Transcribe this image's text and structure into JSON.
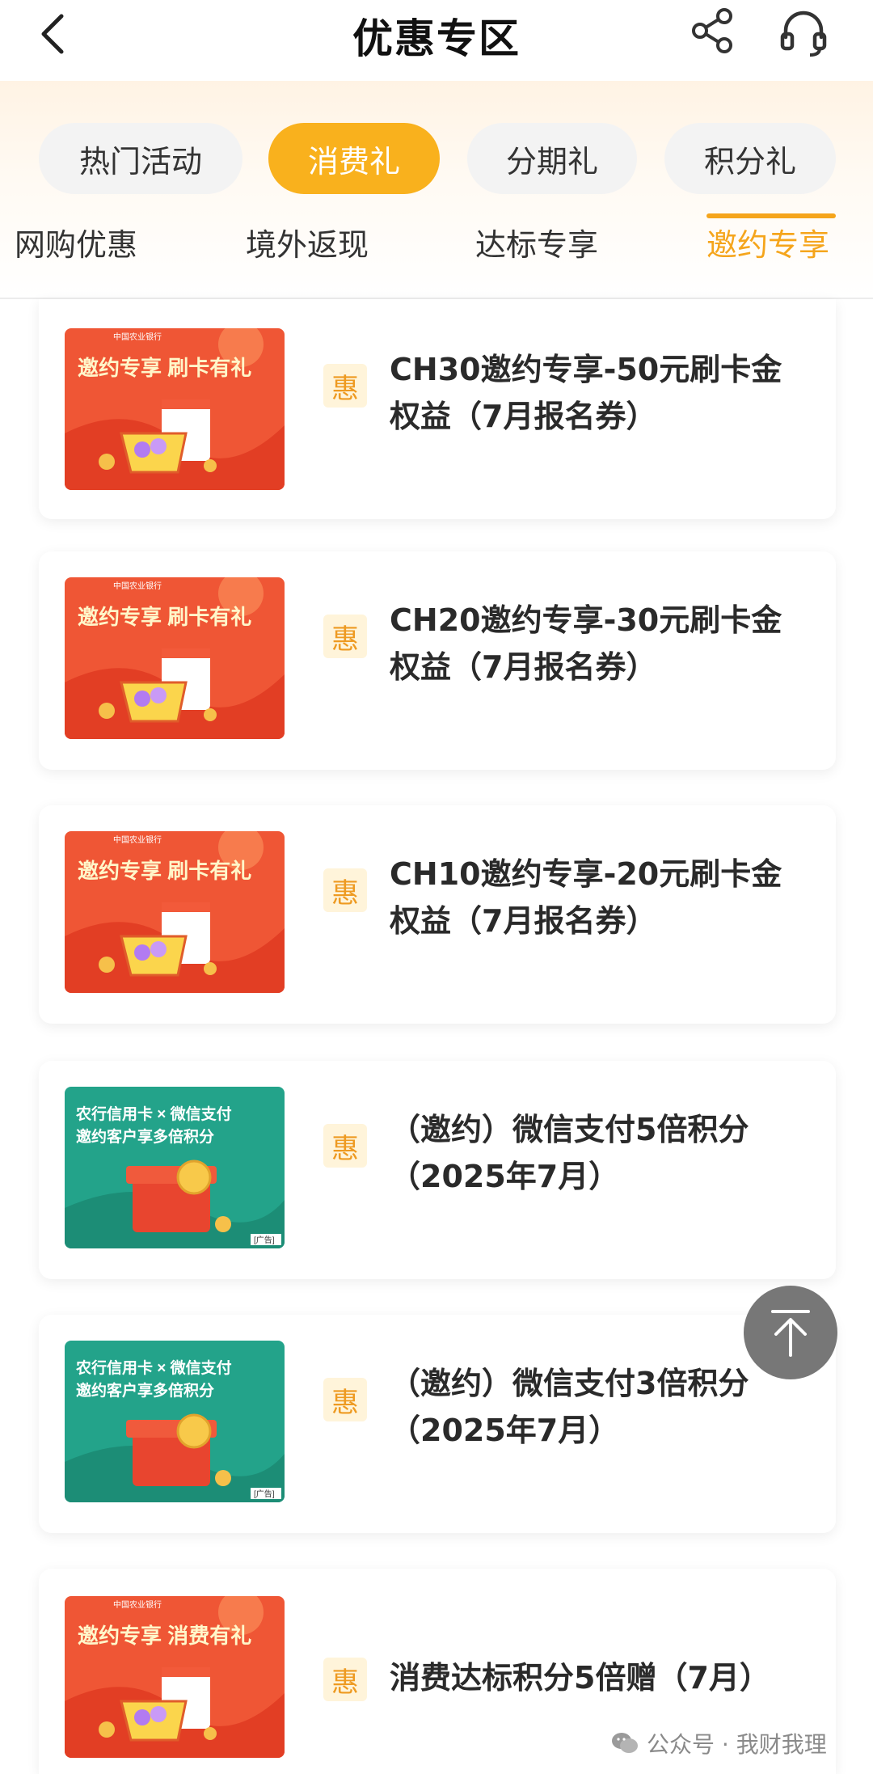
{
  "header": {
    "title": "优惠专区",
    "back_icon": "chevron-left-icon",
    "share_icon": "share-icon",
    "support_icon": "headset-icon"
  },
  "category_tabs": [
    {
      "label": "热门活动",
      "active": false
    },
    {
      "label": "消费礼",
      "active": true
    },
    {
      "label": "分期礼",
      "active": false
    },
    {
      "label": "积分礼",
      "active": false
    }
  ],
  "sub_tabs": [
    {
      "label": "网购优惠",
      "active": false
    },
    {
      "label": "境外返现",
      "active": false
    },
    {
      "label": "达标专享",
      "active": false
    },
    {
      "label": "邀约专享",
      "active": true
    }
  ],
  "banners": {
    "bank_name": "中国农业银行",
    "red_banner_text": "邀约专享 刷卡有礼",
    "red_banner_text_alt": "邀约专享 消费有礼",
    "green_banner_line1": "农行信用卡 × 微信支付",
    "green_banner_line2": "邀约客户享多倍积分",
    "ad_tag": "[广告]"
  },
  "offers": [
    {
      "badge": "惠",
      "title_line1": "CH30邀约专享-50元刷卡金",
      "title_line2": "权益（7月报名券）",
      "banner": "red-card"
    },
    {
      "badge": "惠",
      "title_line1": "CH20邀约专享-30元刷卡金",
      "title_line2": "权益（7月报名券）",
      "banner": "red-card"
    },
    {
      "badge": "惠",
      "title_line1": "CH10邀约专享-20元刷卡金",
      "title_line2": "权益（7月报名券）",
      "banner": "red-card"
    },
    {
      "badge": "惠",
      "title_line1": "（邀约）微信支付5倍积分",
      "title_line2": "（2025年7月）",
      "banner": "green-wechat"
    },
    {
      "badge": "惠",
      "title_line1": "（邀约）微信支付3倍积分",
      "title_line2": "（2025年7月）",
      "banner": "green-wechat"
    },
    {
      "badge": "惠",
      "title_line1": "消费达标积分5倍赠（7月）",
      "title_line2": "",
      "banner": "red-consume"
    }
  ],
  "scroll_top_icon": "arrow-up-to-top-icon",
  "watermark": {
    "text": "公众号 · 我财我理",
    "icon": "wechat-icon"
  },
  "colors": {
    "accent": "#f9b11d",
    "subtab_active": "#f5a51c",
    "badge_bg": "#fff4da",
    "badge_text": "#ee9a21",
    "red_banner": "#ea4a30",
    "green_banner": "#23a38a"
  }
}
